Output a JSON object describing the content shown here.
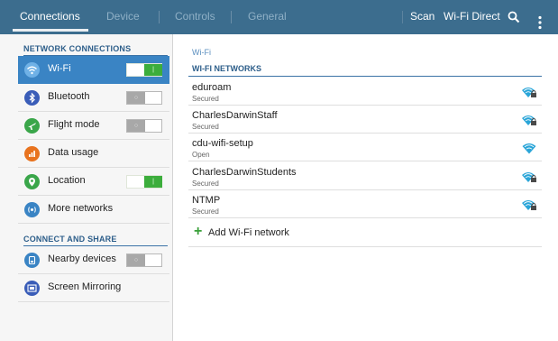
{
  "topbar": {
    "tabs": [
      {
        "label": "Connections",
        "active": true
      },
      {
        "label": "Device",
        "active": false
      },
      {
        "label": "Controls",
        "active": false
      },
      {
        "label": "General",
        "active": false
      }
    ],
    "actions": {
      "scan_label": "Scan",
      "wifi_direct_label": "Wi-Fi Direct",
      "search_icon": "search-icon",
      "more_icon": "more-vertical-icon"
    }
  },
  "sidebar": {
    "network_header": "NETWORK CONNECTIONS",
    "network_items": [
      {
        "label": "Wi-Fi",
        "icon": "wifi-icon",
        "color": "#3a84c4",
        "toggle": "on",
        "selected": true
      },
      {
        "label": "Bluetooth",
        "icon": "bluetooth-icon",
        "color": "#3a5db8",
        "toggle": "off"
      },
      {
        "label": "Flight mode",
        "icon": "airplane-icon",
        "color": "#3aa64a",
        "toggle": "off"
      },
      {
        "label": "Data usage",
        "icon": "data-usage-icon",
        "color": "#e8731f",
        "toggle": null
      },
      {
        "label": "Location",
        "icon": "location-icon",
        "color": "#3aa64a",
        "toggle": "on"
      },
      {
        "label": "More networks",
        "icon": "more-networks-icon",
        "color": "#3a84c4",
        "toggle": null
      }
    ],
    "share_header": "CONNECT AND SHARE",
    "share_items": [
      {
        "label": "Nearby devices",
        "icon": "nearby-devices-icon",
        "color": "#3a84c4",
        "toggle": "off"
      },
      {
        "label": "Screen Mirroring",
        "icon": "screen-mirroring-icon",
        "color": "#3a5db8",
        "toggle": null
      }
    ]
  },
  "main": {
    "breadcrumb": "Wi-Fi",
    "list_header": "WI-FI NETWORKS",
    "networks": [
      {
        "name": "eduroam",
        "status": "Secured",
        "icon": "wifi-lock-icon"
      },
      {
        "name": "CharlesDarwinStaff",
        "status": "Secured",
        "icon": "wifi-lock-icon"
      },
      {
        "name": "cdu-wifi-setup",
        "status": "Open",
        "icon": "wifi-icon"
      },
      {
        "name": "CharlesDarwinStudents",
        "status": "Secured",
        "icon": "wifi-lock-icon"
      },
      {
        "name": "NTMP",
        "status": "Secured",
        "icon": "wifi-lock-icon"
      }
    ],
    "add_network_label": "Add Wi-Fi network"
  },
  "colors": {
    "topbar": "#3c6d8e",
    "accent": "#3a84c4",
    "toggle_on": "#3cad3c",
    "section_header": "#2d5e8a",
    "wifi_signal": "#2aa5d8"
  }
}
